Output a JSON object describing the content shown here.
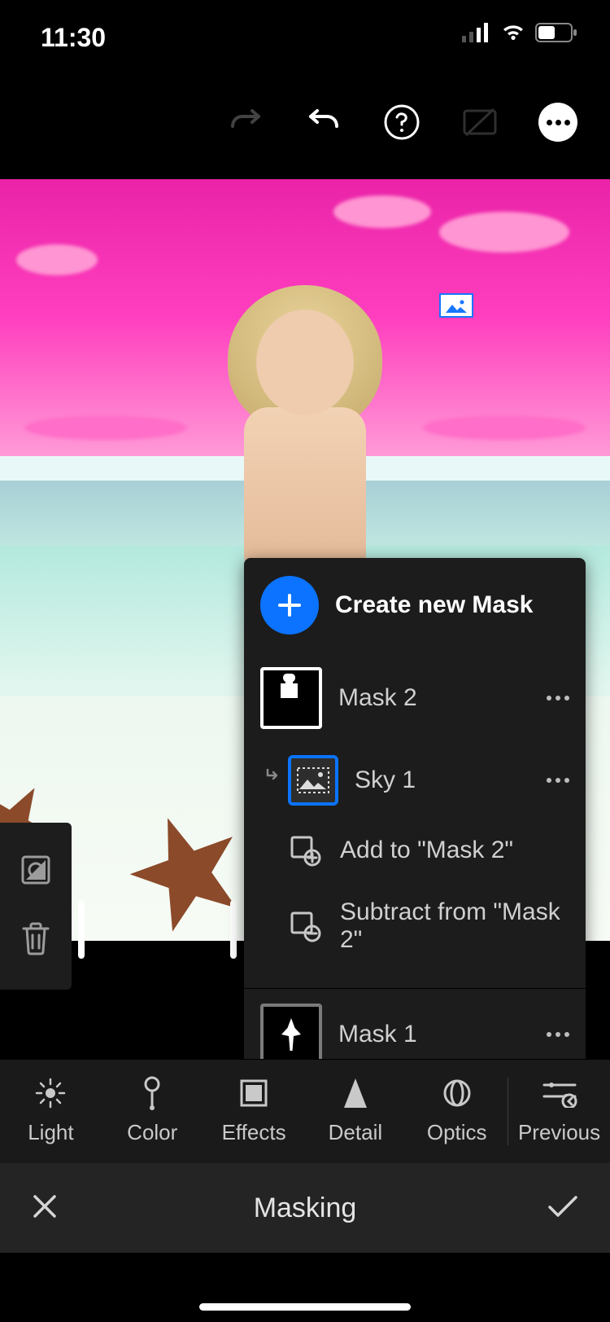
{
  "status": {
    "time": "11:30"
  },
  "mask_panel": {
    "create_label": "Create new Mask",
    "mask2_label": "Mask 2",
    "sky_label": "Sky 1",
    "add_label": "Add to \"Mask 2\"",
    "subtract_label": "Subtract from \"Mask 2\"",
    "mask1_label": "Mask 1"
  },
  "tabs": {
    "light": "Light",
    "color": "Color",
    "effects": "Effects",
    "detail": "Detail",
    "optics": "Optics",
    "previous": "Previous"
  },
  "bottom": {
    "title": "Masking"
  }
}
